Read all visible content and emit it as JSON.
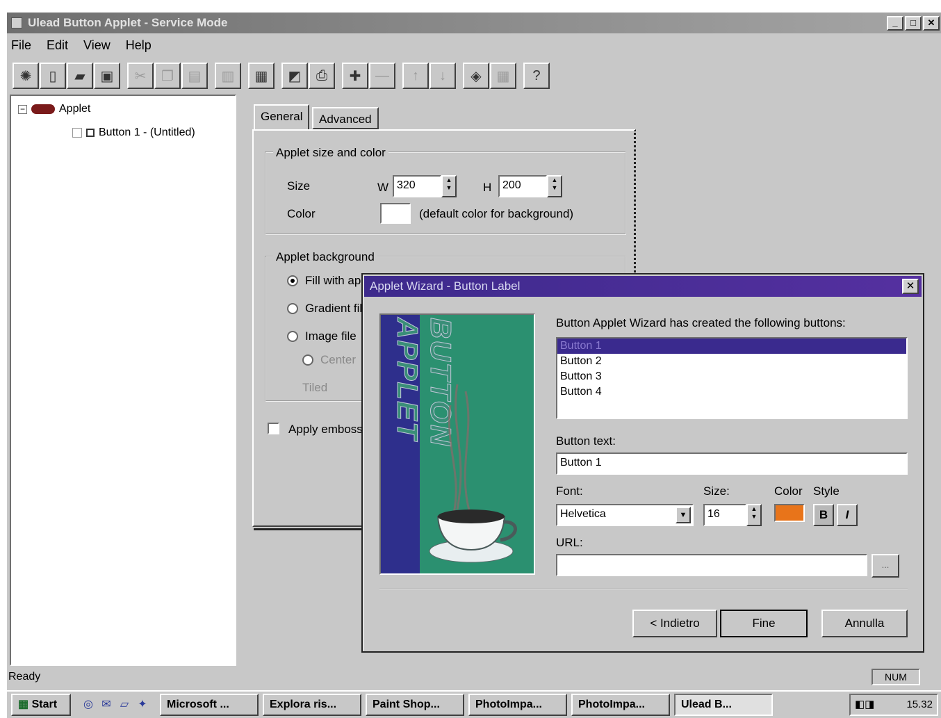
{
  "window": {
    "title": "Ulead Button Applet - Service Mode"
  },
  "menu": [
    "File",
    "Edit",
    "View",
    "Help"
  ],
  "toolbar": {
    "groups": [
      [
        {
          "icon": "ant-icon",
          "glyph": "✺",
          "enabled": true
        },
        {
          "icon": "new-icon",
          "glyph": "▯",
          "enabled": true
        },
        {
          "icon": "open-icon",
          "glyph": "▰",
          "enabled": true
        },
        {
          "icon": "save-icon",
          "glyph": "▣",
          "enabled": true
        }
      ],
      [
        {
          "icon": "cut-icon",
          "glyph": "✂",
          "enabled": false
        },
        {
          "icon": "copy-icon",
          "glyph": "❐",
          "enabled": false
        },
        {
          "icon": "paste-icon",
          "glyph": "▤",
          "enabled": false
        }
      ],
      [
        {
          "icon": "delete-icon",
          "glyph": "▥",
          "enabled": false
        }
      ],
      [
        {
          "icon": "properties-icon",
          "glyph": "▦",
          "enabled": true
        }
      ],
      [
        {
          "icon": "preview-icon",
          "glyph": "◩",
          "enabled": true
        },
        {
          "icon": "print-icon",
          "glyph": "⎙",
          "enabled": true
        }
      ],
      [
        {
          "icon": "add-button-icon",
          "glyph": "✚",
          "enabled": true
        },
        {
          "icon": "remove-button-icon",
          "glyph": "—",
          "enabled": false
        }
      ],
      [
        {
          "icon": "move-up-icon",
          "glyph": "↑",
          "enabled": false
        },
        {
          "icon": "move-down-icon",
          "glyph": "↓",
          "enabled": false
        }
      ],
      [
        {
          "icon": "wizard-icon",
          "glyph": "◈",
          "enabled": true
        },
        {
          "icon": "grid-icon",
          "glyph": "▦",
          "enabled": false
        }
      ],
      [
        {
          "icon": "help-icon",
          "glyph": "?",
          "enabled": true
        }
      ]
    ]
  },
  "tree": {
    "root": "Applet",
    "child": "Button 1 - (Untitled)"
  },
  "tabs": [
    "General",
    "Advanced"
  ],
  "general": {
    "size_group": "Applet size and color",
    "size_label": "Size",
    "w_label": "W",
    "w_value": "320",
    "h_label": "H",
    "h_value": "200",
    "color_label": "Color",
    "color_hint": "(default color for background)",
    "bg_group": "Applet background",
    "opt_fill": "Fill with applet color",
    "opt_gradient": "Gradient fill",
    "opt_image": "Image file",
    "sub_option": "Center",
    "sub_option2": "Tiled",
    "emboss": "Apply emboss"
  },
  "wizard": {
    "title": "Applet Wizard - Button Label",
    "image_text": "BUTTON APPLET",
    "intro": "Button Applet Wizard has created the following buttons:",
    "buttons": [
      "Button 1",
      "Button 2",
      "Button 3",
      "Button 4"
    ],
    "selected_index": 0,
    "button_text_label": "Button text:",
    "button_text_value": "Button 1",
    "font_label": "Font:",
    "font_value": "Helvetica",
    "size_label": "Size:",
    "size_value": "16",
    "color_label": "Color",
    "color_value": "#e8741a",
    "style_label": "Style",
    "bold": "B",
    "italic": "I",
    "url_label": "URL:",
    "url_value": "",
    "back": "< Indietro",
    "finish": "Fine",
    "cancel": "Annulla"
  },
  "status": {
    "text": "Ready",
    "num": "NUM"
  },
  "taskbar": {
    "start": "Start",
    "tasks": [
      "Microsoft ...",
      "Explora ris...",
      "Paint Shop...",
      "PhotoImpa...",
      "PhotoImpa...",
      "Ulead B..."
    ],
    "active_index": 5,
    "clock": "15.32"
  }
}
